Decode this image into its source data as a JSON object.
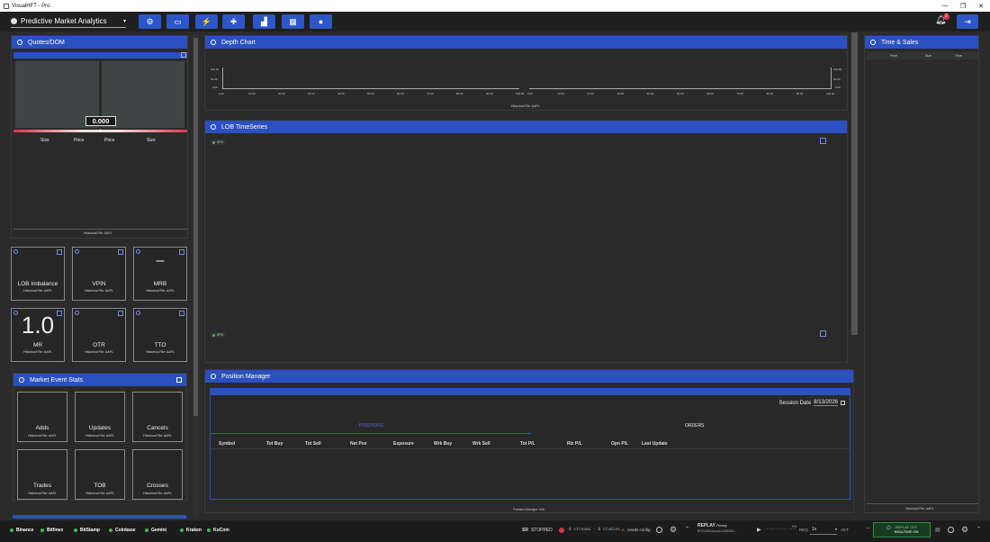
{
  "window": {
    "title": "VisualHFT - Pro",
    "controls": [
      "—",
      "❐",
      "✕"
    ]
  },
  "toolbar": {
    "provider": "Predictive Market Analytics",
    "notification_count": "2"
  },
  "quotes": {
    "title": "Quotes/DOM",
    "mid_value": "0.000",
    "columns": [
      "Size",
      "Price",
      "Price",
      "Size"
    ],
    "footer": "Historical File: AAPL"
  },
  "tiles": [
    {
      "value": "",
      "label": "LOB Imbalance",
      "sub": "Historical File: AAPL"
    },
    {
      "value": "",
      "label": "VPIN",
      "sub": "Historical File: AAPL"
    },
    {
      "value": "–",
      "label": "MRB",
      "sub": "Historical File: AAPL"
    },
    {
      "value": "1.0",
      "label": "MR",
      "sub": "Historical File: AAPL"
    },
    {
      "value": "",
      "label": "OTR",
      "sub": "Historical File: AAPL"
    },
    {
      "value": "",
      "label": "TTO",
      "sub": "Historical File: AAPL"
    }
  ],
  "market_stats": {
    "title": "Market Event Stats",
    "items": [
      {
        "label": "Adds",
        "sub": "Historical File: AAPL"
      },
      {
        "label": "Updates",
        "sub": "Historical File: AAPL"
      },
      {
        "label": "Cancels",
        "sub": "Historical File: AAPL"
      },
      {
        "label": "Trades",
        "sub": "Historical File: AAPL"
      },
      {
        "label": "TOB",
        "sub": "Historical File: AAPL"
      },
      {
        "label": "Crosses",
        "sub": "Historical File: AAPL"
      }
    ]
  },
  "depth": {
    "title": "Depth Chart",
    "y_ticks_left": [
      "100.00",
      "50.00",
      "0.00"
    ],
    "y_ticks_right": [
      "100.00",
      "50.00",
      "0.00"
    ],
    "x_ticks_left": [
      "0.00",
      "10.00",
      "20.00",
      "30.00",
      "40.00",
      "50.00",
      "60.00",
      "70.00",
      "80.00",
      "90.00",
      "100.00"
    ],
    "x_ticks_right": [
      "0.00",
      "10.00",
      "20.00",
      "30.00",
      "40.00",
      "50.00",
      "60.00",
      "70.00",
      "80.00",
      "90.00",
      "100.00"
    ],
    "footer": "Historical File: AAPL"
  },
  "lob": {
    "title": "LOB TimeSeries",
    "badge_top": "SPU",
    "badge_bottom": "SPU"
  },
  "positions": {
    "title": "Position Manager",
    "session_label": "Session Date",
    "session_date": "8/13/2026",
    "tab_positions": "POSITIONS",
    "tab_orders": "ORDERS",
    "columns": [
      "Symbol",
      "Tot Buy",
      "Tot Sell",
      "Net Pos",
      "Exposure",
      "Wrk Buy",
      "Wrk Sell",
      "Tot P/L",
      "Rlz P/L",
      "Opn P/L",
      "Last Update"
    ],
    "footer": "Position Manager: N/A"
  },
  "time_sales": {
    "title": "Time & Sales",
    "columns": [
      "Price",
      "Size",
      "Time"
    ],
    "footer": "Historical File: AAPL"
  },
  "status": {
    "exchanges": [
      "Binance",
      "Bitfinex",
      "BitStamp",
      "Coinbase",
      "Gemini",
      "Kraken",
      "KuCoin"
    ],
    "sr_label": "SR",
    "sr_state": "STOPPED",
    "streams": "0 streams · 0 studies",
    "needs_config": "needs config",
    "replay_label": "REPLAY",
    "replay_state": "Ready",
    "replay_file": "BTCUSD-kucoin-2026062...",
    "time_display": "--:--:--.---",
    "pct": "0%",
    "req": "REQ",
    "speed": "1x",
    "act": "ACT",
    "replay_off": "REPLAY OFF",
    "realtime_on": "REALTIME ON"
  },
  "colors": {
    "accent": "#2b50c0",
    "green": "#3fb950",
    "red": "#e0324a"
  }
}
